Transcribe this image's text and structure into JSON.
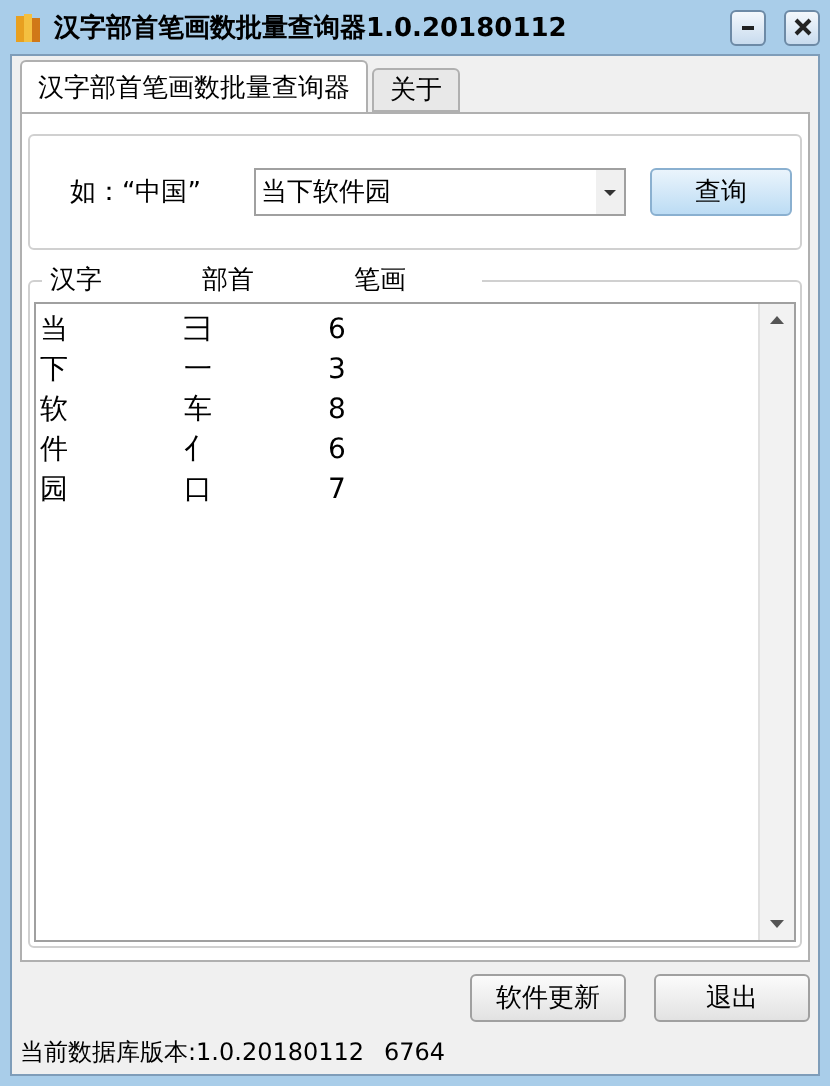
{
  "window": {
    "title": "汉字部首笔画数批量查询器1.0.20180112"
  },
  "tabs": [
    {
      "label": "汉字部首笔画数批量查询器",
      "selected": true
    },
    {
      "label": "关于",
      "selected": false
    }
  ],
  "query": {
    "hint": "如：“中国”",
    "value": "当下软件园",
    "button": "查询"
  },
  "table": {
    "columns": [
      "汉字",
      "部首",
      "笔画"
    ],
    "rows": [
      [
        "当",
        "彐",
        "6"
      ],
      [
        "下",
        "一",
        "3"
      ],
      [
        "软",
        "车",
        "8"
      ],
      [
        "件",
        "亻",
        "6"
      ],
      [
        "园",
        "口",
        "7"
      ]
    ]
  },
  "buttons": [
    "软件更新",
    "退出"
  ],
  "status_bar": {
    "text": "当前数据库版本:1.0.20180112",
    "count": "6764"
  }
}
